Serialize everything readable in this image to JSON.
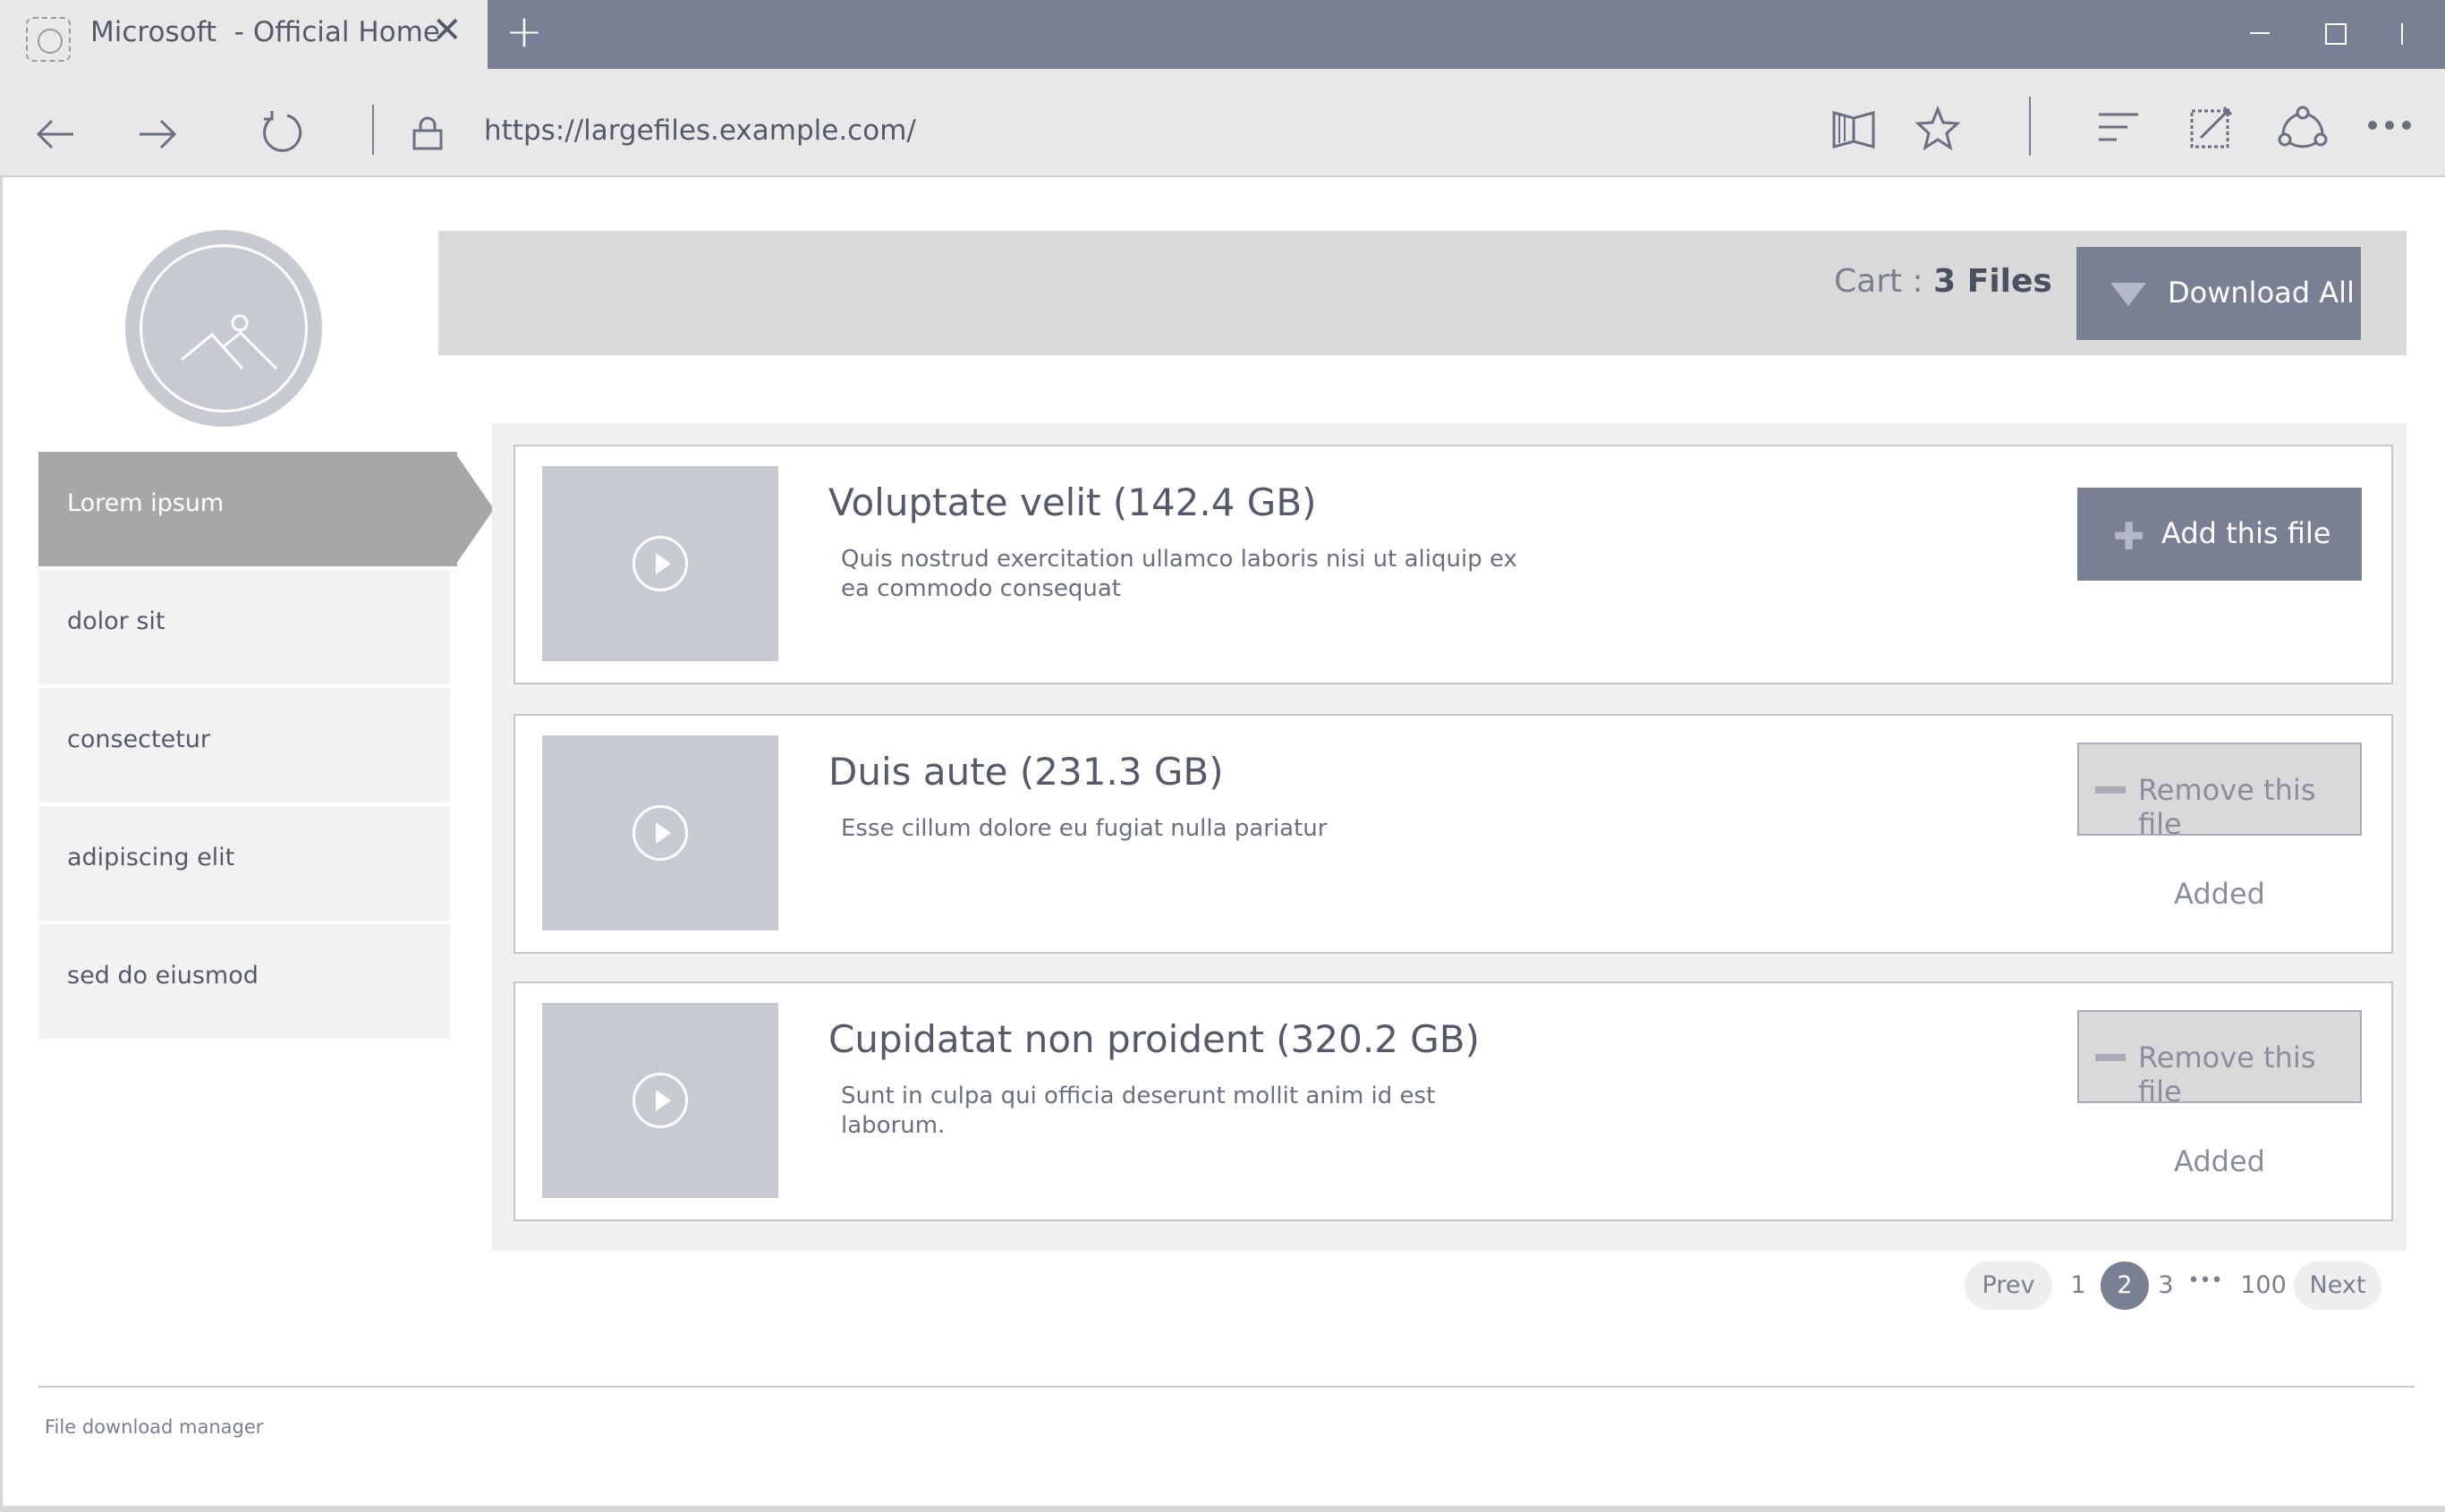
{
  "browser": {
    "tab_title": "Microsoft  - Official Home",
    "close_tab_glyph": "✕",
    "new_tab_glyph": "+",
    "url": "https://largefiles.example.com/",
    "icons": [
      "back-icon",
      "forward-icon",
      "refresh-icon",
      "lock-icon",
      "reading-view-icon",
      "favorite-star-icon",
      "hub-icon",
      "web-note-icon",
      "share-icon",
      "more-icon"
    ]
  },
  "sidebar": {
    "items": [
      {
        "label": "Lorem ipsum",
        "active": true
      },
      {
        "label": "dolor sit"
      },
      {
        "label": "consectetur"
      },
      {
        "label": "adipiscing elit"
      },
      {
        "label": "sed do eiusmod"
      }
    ]
  },
  "cart": {
    "prefix": "Cart : ",
    "count_label": "3 Files",
    "download_all_label": "Download All"
  },
  "files": [
    {
      "title": "Voluptate velit (142.4 GB)",
      "description": "Quis nostrud exercitation ullamco laboris nisi ut aliquip ex ea commodo consequat",
      "action_label": "Add this file",
      "added": false
    },
    {
      "title": "Duis aute (231.3 GB)",
      "description": "Esse cillum dolore eu fugiat nulla pariatur",
      "action_label": "Remove this file",
      "status": "Added",
      "added": true
    },
    {
      "title": "Cupidatat non proident (320.2 GB)",
      "description": "Sunt in culpa qui officia deserunt mollit anim id est laborum.",
      "action_label": "Remove this file",
      "status": "Added",
      "added": true
    }
  ],
  "pagination": {
    "prev": "Prev",
    "pages": [
      "1",
      "2",
      "3"
    ],
    "current": "2",
    "ellipsis": "•••",
    "last": "100",
    "next": "Next"
  },
  "footer": {
    "text": "File download manager"
  },
  "colors": {
    "accent": "#7a8094",
    "sidebar_active": "#a7a7aa",
    "placeholder": "#c8cad2"
  }
}
